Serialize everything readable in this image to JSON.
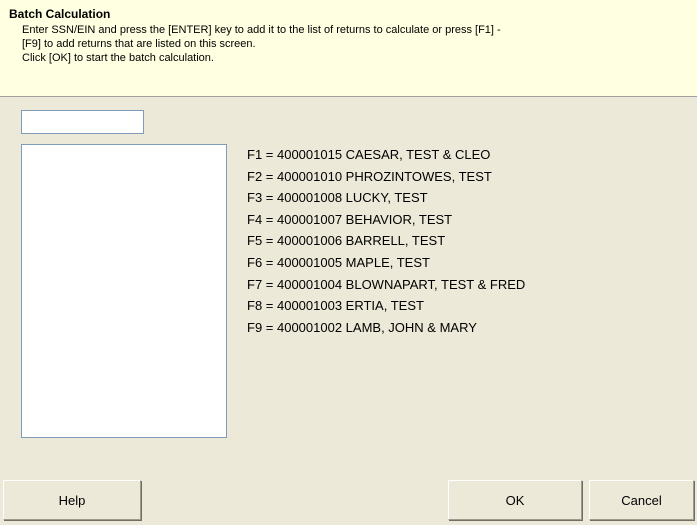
{
  "header": {
    "title": "Batch Calculation",
    "line1": "Enter SSN/EIN and press the [ENTER] key to add it to the list of returns to calculate or press [F1] -",
    "line2": "[F9] to add returns that are listed on this screen.",
    "line3": "Click [OK] to start the batch calculation."
  },
  "ssn_input": {
    "value": "",
    "placeholder": ""
  },
  "returns": [
    {
      "label": "F1 = 400001015 CAESAR, TEST & CLEO"
    },
    {
      "label": "F2 = 400001010 PHROZINTOWES, TEST"
    },
    {
      "label": "F3 = 400001008 LUCKY, TEST"
    },
    {
      "label": "F4 = 400001007 BEHAVIOR, TEST"
    },
    {
      "label": "F5 = 400001006 BARRELL, TEST"
    },
    {
      "label": "F6 = 400001005 MAPLE, TEST"
    },
    {
      "label": "F7 = 400001004 BLOWNAPART, TEST & FRED"
    },
    {
      "label": "F8 = 400001003 ERTIA, TEST"
    },
    {
      "label": "F9 = 400001002 LAMB, JOHN & MARY"
    }
  ],
  "buttons": {
    "help": "Help",
    "ok": "OK",
    "cancel": "Cancel"
  },
  "colors": {
    "header_background": "#ffffe1",
    "dialog_background": "#ece9d8",
    "field_border": "#7f9db9"
  }
}
